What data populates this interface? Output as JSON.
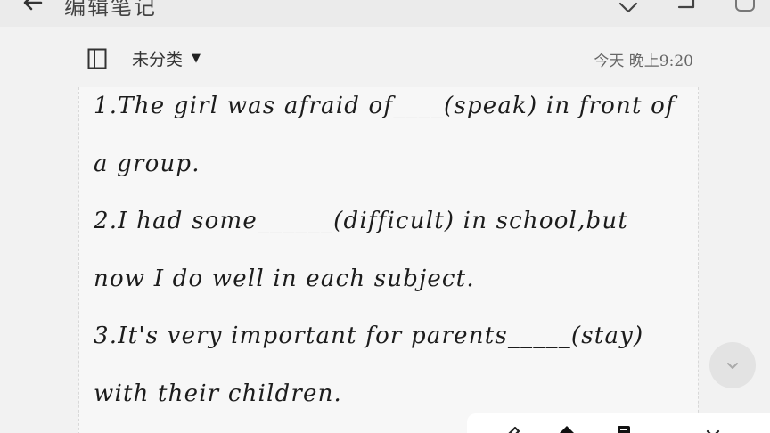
{
  "app": {
    "title": "编辑笔记"
  },
  "meta": {
    "category": "未分类",
    "timestamp": "今天 晚上9:20"
  },
  "note": {
    "lines": [
      "1.The girl was afraid of____(speak) in front of",
      "a group.",
      "2.I had some______(difficult) in school,but",
      "now I do well in each subject.",
      "3.It's very important for parents_____(stay)",
      "with their children."
    ]
  },
  "icons": {
    "back": "back-arrow-icon",
    "undo": "undo-icon",
    "redo": "redo-icon",
    "more": "more-icon",
    "notebook": "notebook-icon",
    "dropdown": "caret-down-icon",
    "scroll": "chevron-down-icon",
    "pen": "pen-icon",
    "brush": "brush-icon",
    "note": "note-icon",
    "close": "close-icon"
  }
}
